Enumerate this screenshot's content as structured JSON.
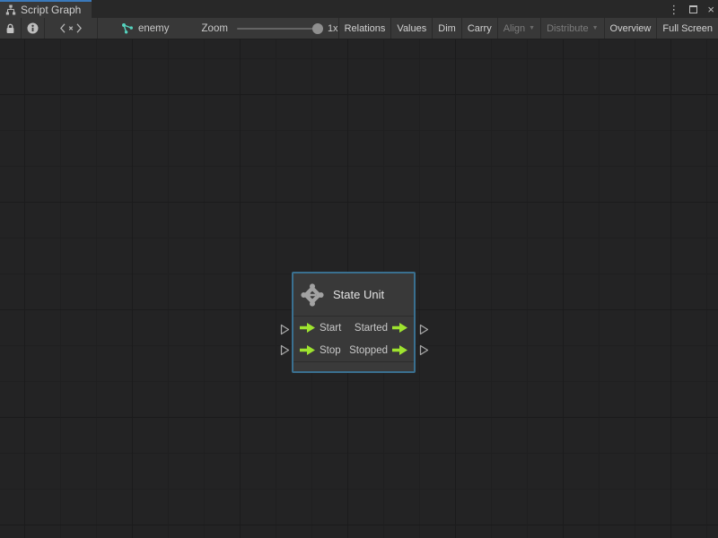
{
  "window": {
    "tab_title": "Script Graph",
    "controls": {
      "menu_glyph": "⋮",
      "close_glyph": "×"
    }
  },
  "toolbar": {
    "graph_name": "enemy",
    "zoom": {
      "label": "Zoom",
      "value": "1x"
    },
    "dropdown_glyph": "▼",
    "buttons": [
      {
        "label": "Relations",
        "enabled": true
      },
      {
        "label": "Values",
        "enabled": true
      },
      {
        "label": "Dim",
        "enabled": true
      },
      {
        "label": "Carry",
        "enabled": true
      },
      {
        "label": "Align",
        "enabled": false,
        "dropdown": true
      },
      {
        "label": "Distribute",
        "enabled": false,
        "dropdown": true
      },
      {
        "label": "Overview",
        "enabled": true
      },
      {
        "label": "Full Screen",
        "enabled": true
      }
    ]
  },
  "node": {
    "title": "State Unit",
    "ports": {
      "inputs": [
        {
          "label": "Start"
        },
        {
          "label": "Stop"
        }
      ],
      "outputs": [
        {
          "label": "Started"
        },
        {
          "label": "Stopped"
        }
      ]
    }
  },
  "colors": {
    "tab_accent": "#3a79bb",
    "node_border": "#3a7090",
    "port_arrow_green": "#9ee32f",
    "graph_icon_teal": "#55d3be"
  }
}
